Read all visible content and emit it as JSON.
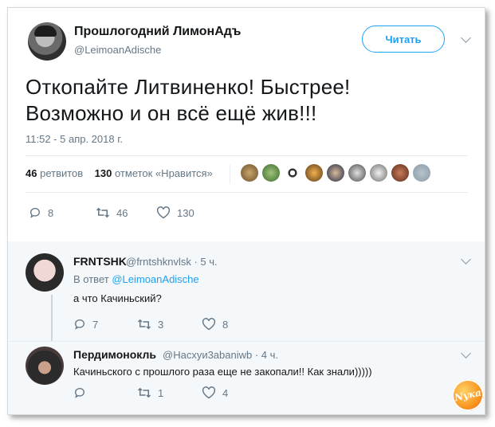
{
  "tweet": {
    "author_name": "Прошлогодний ЛимонАдъ",
    "author_handle": "@LeimoanAdische",
    "follow_label": "Читать",
    "text_line1": "Откопайте Литвиненко! Быстрее!",
    "text_line2": "Возможно и он всё ещё жив!!!",
    "timestamp": "11:52 - 5 апр. 2018 г.",
    "retweets_count": "46",
    "retweets_label": "ретвитов",
    "likes_count": "130",
    "likes_label": "отметок «Нравится»",
    "actions": {
      "replies": "8",
      "retweets": "46",
      "likes": "130"
    }
  },
  "replies": [
    {
      "name": "FRNTSHK",
      "handle": "@frntshknvlsk",
      "time": "· 5 ч.",
      "reply_to_label": "В ответ",
      "reply_to_handle": "@LeimoanAdische",
      "text": "а что Качиньский?",
      "actions": {
        "replies": "7",
        "retweets": "3",
        "likes": "8"
      }
    },
    {
      "name": "Пердимонокль",
      "handle": "@Насхуи3abaniwb",
      "time": "· 4 ч.",
      "text": "Качиньского с прошлого раза еще не закопали!!  Как знали)))))",
      "actions": {
        "replies": "",
        "retweets": "1",
        "likes": "4"
      }
    }
  ],
  "watermark": "Nука",
  "colors": {
    "accent": "#1da1f2",
    "muted": "#657786",
    "text": "#14171a",
    "reply_bg": "#f5f8fa"
  }
}
